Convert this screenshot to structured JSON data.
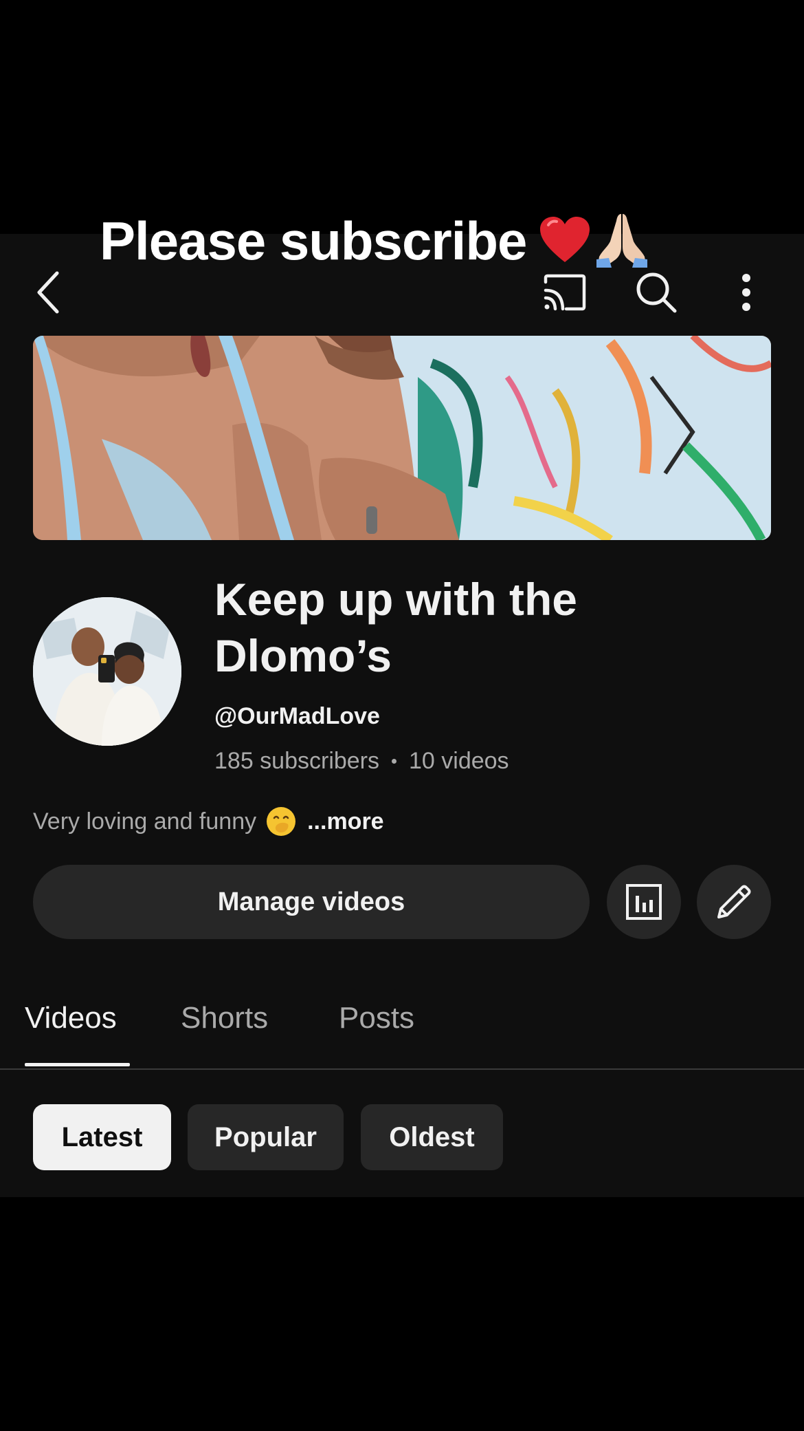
{
  "caption": {
    "text": "Please subscribe"
  },
  "topbar": {
    "back_icon": "chevron-left-icon",
    "cast_icon": "cast-icon",
    "search_icon": "search-icon",
    "more_icon": "more-vertical-icon"
  },
  "channel": {
    "name": "Keep up with the Dlomo’s",
    "handle": "@OurMadLove",
    "subscribers": "185 subscribers",
    "videos": "10 videos",
    "description": "Very loving and funny",
    "more_label": "...more"
  },
  "actions": {
    "manage_label": "Manage videos",
    "analytics_icon": "analytics-icon",
    "edit_icon": "pencil-icon"
  },
  "tabs": [
    {
      "label": "Videos",
      "active": true
    },
    {
      "label": "Shorts",
      "active": false
    },
    {
      "label": "Posts",
      "active": false
    }
  ],
  "filters": [
    {
      "label": "Latest",
      "selected": true
    },
    {
      "label": "Popular",
      "selected": false
    },
    {
      "label": "Oldest",
      "selected": false
    }
  ],
  "colors": {
    "background": "#0f0f0f",
    "surface": "#272727",
    "text_primary": "#f1f1f1",
    "text_secondary": "#aaaaaa",
    "heart": "#e0242f"
  }
}
